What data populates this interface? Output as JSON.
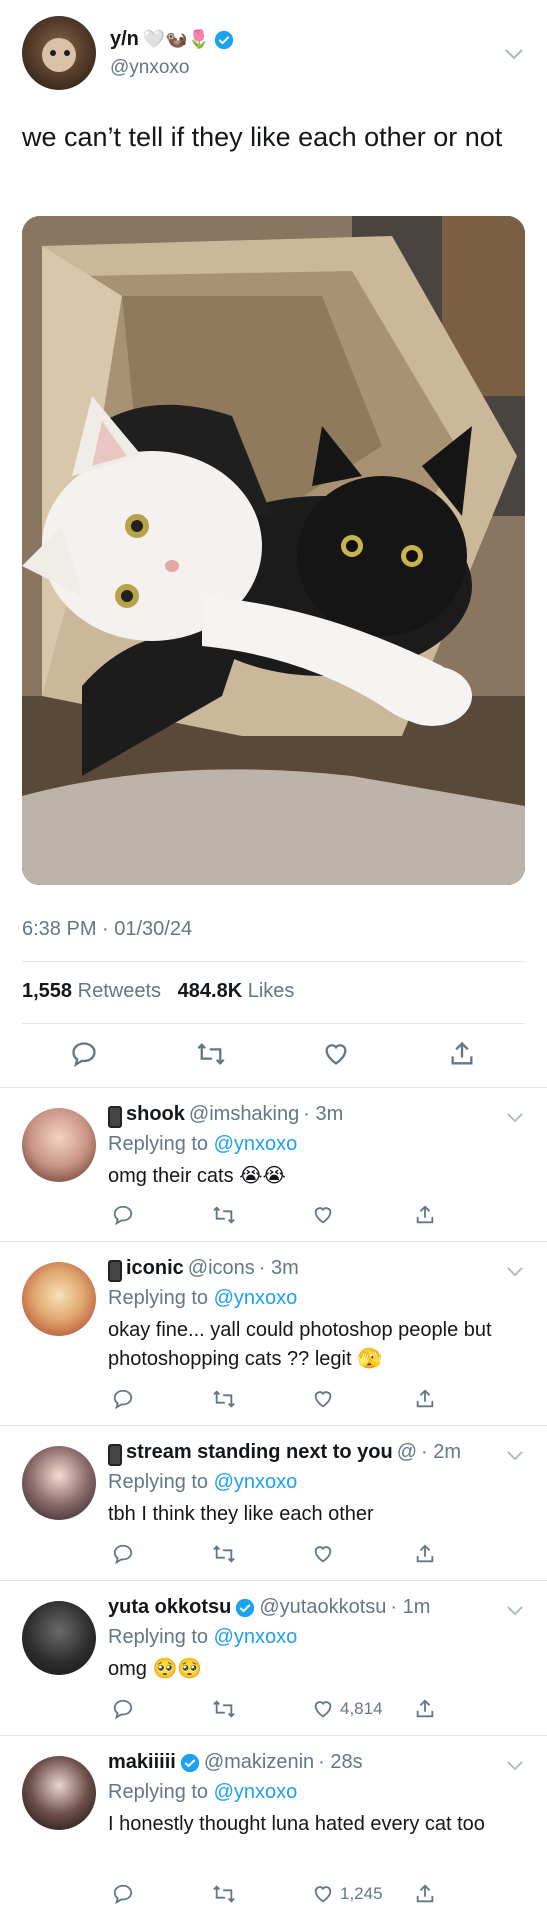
{
  "tweet": {
    "name": "y/n",
    "name_emojis": "🤍🦦🌷",
    "handle": "@ynxoxo",
    "text": "we can’t tell if they like each other or not",
    "timestamp": "6:38 PM · 01/30/24",
    "retweets_count": "1,558",
    "retweets_label": "Retweets",
    "likes_count": "484.8K",
    "likes_label": "Likes"
  },
  "replies": [
    {
      "name": "shook",
      "handle": "@imshaking",
      "time": "· 3m",
      "replying_prefix": "Replying to",
      "replying_to": "@ynxoxo",
      "text": "omg their cats 😭😭",
      "likes": ""
    },
    {
      "name": "iconic",
      "handle": "@icons",
      "time": "· 3m",
      "replying_prefix": "Replying to",
      "replying_to": "@ynxoxo",
      "text": "okay fine... yall could photoshop people but photoshopping cats ?? legit 🫣",
      "likes": ""
    },
    {
      "name": "stream standing next to you",
      "handle": "@",
      "time": "· 2m",
      "replying_prefix": "Replying to",
      "replying_to": "@ynxoxo",
      "text": "tbh I think they like each other",
      "likes": ""
    },
    {
      "name": "yuta okkotsu",
      "handle": "@yutaokkotsu",
      "time": "· 1m",
      "replying_prefix": "Replying to",
      "replying_to": "@ynxoxo",
      "text": "omg 🥺🥺",
      "likes": "4,814"
    },
    {
      "name": "makiiiii",
      "handle": "@makizenin",
      "time": "· 28s",
      "replying_prefix": "Replying to",
      "replying_to": "@ynxoxo",
      "text": "I honestly thought luna hated every cat too",
      "likes": "1,245"
    }
  ],
  "colors": {
    "muted": "#657786",
    "link": "#1da1f2",
    "verified": "#1da1f2",
    "divider": "#e1e8ed"
  }
}
